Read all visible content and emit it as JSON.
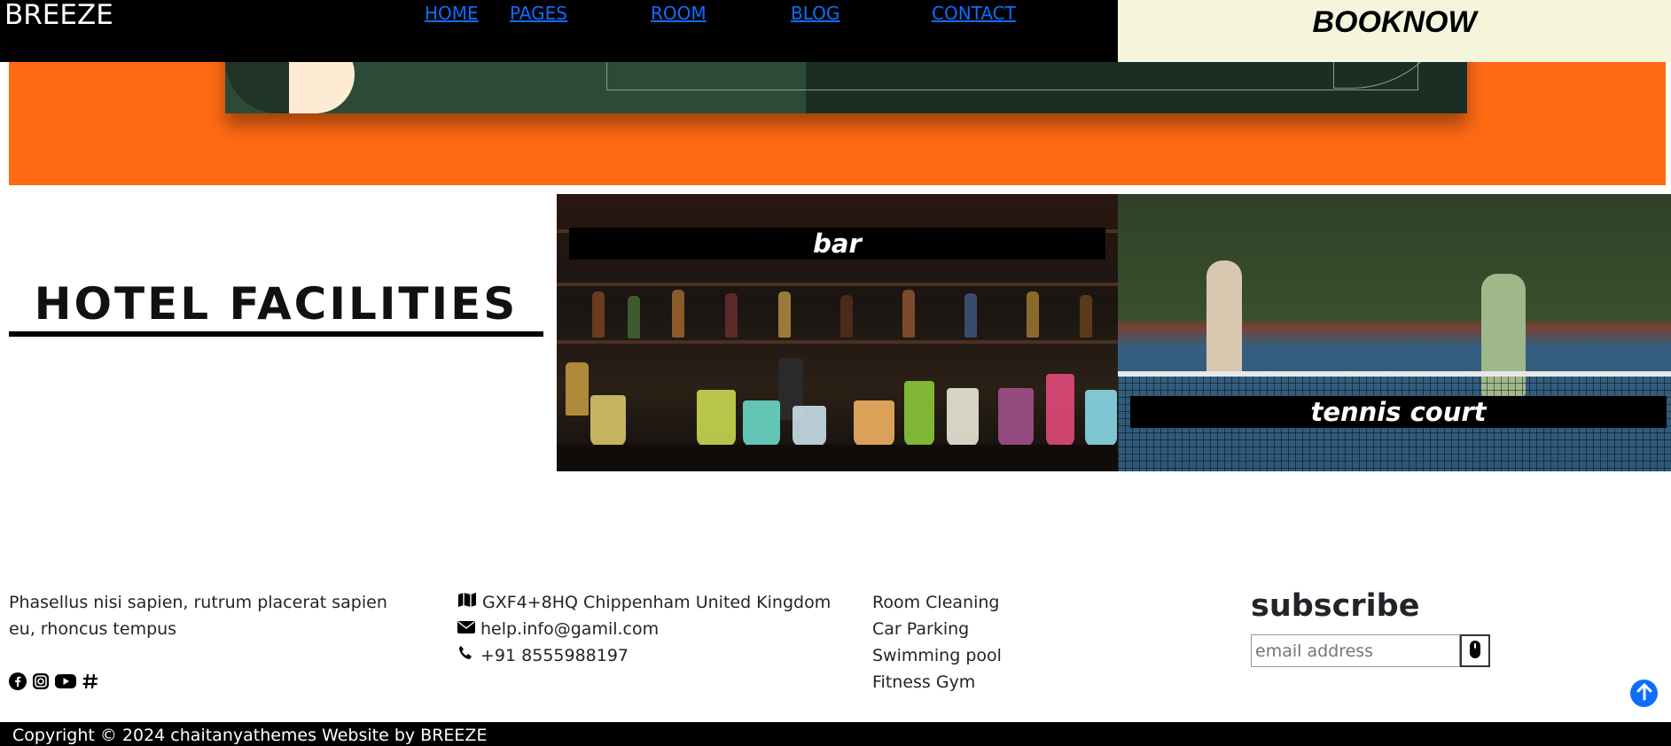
{
  "header": {
    "logo": "BREEZE",
    "nav": [
      "HOME",
      "PAGES",
      "ROOM",
      "BLOG",
      "CONTACT"
    ],
    "book_label": "BOOKNOW"
  },
  "facilities": {
    "title": "HOTEL FACILITIES",
    "tiles": [
      {
        "label": "bar"
      },
      {
        "label": "tennis court"
      }
    ]
  },
  "footer": {
    "description": "Phasellus nisi sapien, rutrum placerat sapien eu, rhoncus tempus",
    "contact": {
      "address": "GXF4+8HQ Chippenham United Kingdom",
      "email": "help.info@gamil.com",
      "phone": "+91 8555988197"
    },
    "services": [
      "Room Cleaning",
      "Car Parking",
      "Swimming pool",
      "Fitness Gym"
    ],
    "subscribe": {
      "title": "subscribe",
      "placeholder": "email address"
    },
    "socials": [
      "facebook-icon",
      "instagram-icon",
      "youtube-icon",
      "hashtag-icon"
    ],
    "copyright": "Copyright © 2024 chaitanyathemes Website by BREEZE"
  },
  "colors": {
    "hero_bg": "#ff6a13",
    "book_bg": "#f5f5dc",
    "link": "#0d6efd"
  }
}
